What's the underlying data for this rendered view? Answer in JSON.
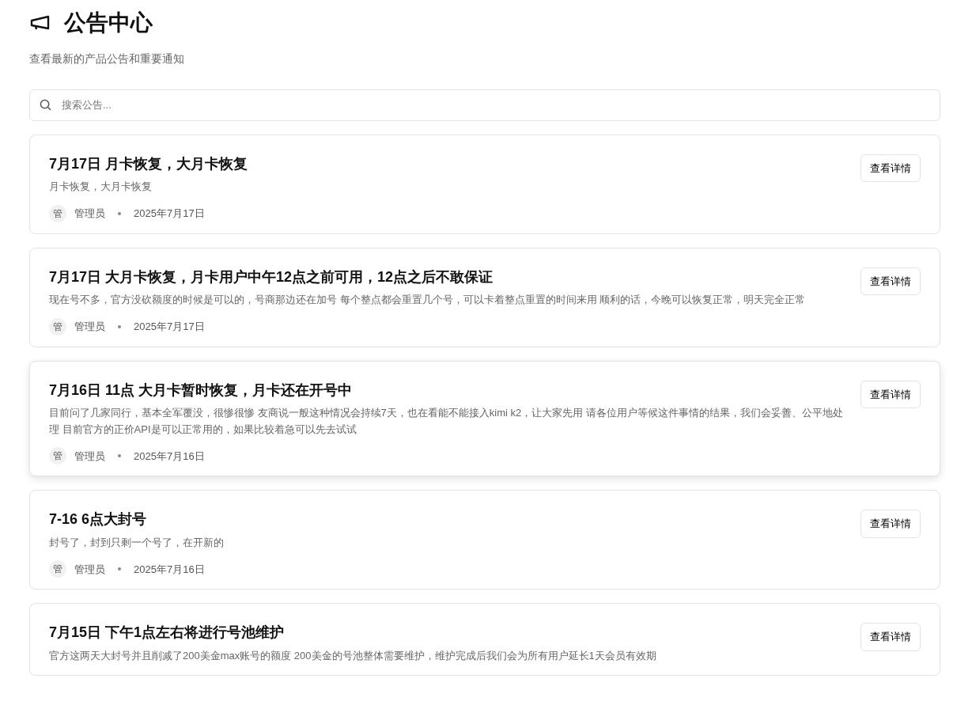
{
  "header": {
    "title": "公告中心",
    "subtitle": "查看最新的产品公告和重要通知"
  },
  "search": {
    "placeholder": "搜索公告..."
  },
  "announcements": [
    {
      "title": "7月17日 月卡恢复，大月卡恢复",
      "summary": "月卡恢复，大月卡恢复",
      "avatar": "管",
      "author": "管理员",
      "date": "2025年7月17日",
      "button": "查看详情",
      "hovered": false
    },
    {
      "title": "7月17日 大月卡恢复，月卡用户中午12点之前可用，12点之后不敢保证",
      "summary": "现在号不多，官方没砍额度的时候是可以的，号商那边还在加号 每个整点都会重置几个号，可以卡着整点重置的时间来用 顺利的话，今晚可以恢复正常，明天完全正常",
      "avatar": "管",
      "author": "管理员",
      "date": "2025年7月17日",
      "button": "查看详情",
      "hovered": false
    },
    {
      "title": "7月16日 11点 大月卡暂时恢复，月卡还在开号中",
      "summary": "目前问了几家同行，基本全军覆没，很惨很惨 友商说一般这种情况会持续7天，也在看能不能接入kimi k2，让大家先用 请各位用户等候这件事情的结果，我们会妥善、公平地处理 目前官方的正价API是可以正常用的，如果比较着急可以先去试试",
      "avatar": "管",
      "author": "管理员",
      "date": "2025年7月16日",
      "button": "查看详情",
      "hovered": true
    },
    {
      "title": "7-16 6点大封号",
      "summary": "封号了，封到只剩一个号了，在开新的",
      "avatar": "管",
      "author": "管理员",
      "date": "2025年7月16日",
      "button": "查看详情",
      "hovered": false
    },
    {
      "title": "7月15日 下午1点左右将进行号池维护",
      "summary": "官方这两天大封号并且削减了200美金max账号的额度 200美金的号池整体需要维护，维护完成后我们会为所有用户延长1天会员有效期",
      "button": "查看详情",
      "hovered": false
    }
  ]
}
